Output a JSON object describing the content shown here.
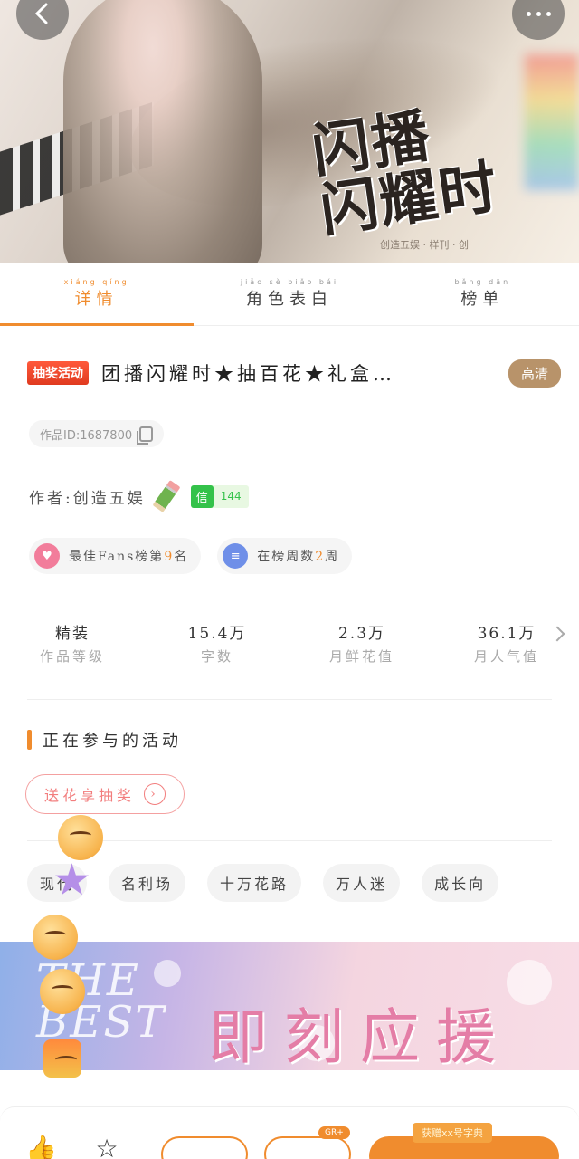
{
  "hero": {
    "title_art": "闪播\n闪耀时",
    "credit": "创造五娱 · 样刊 · 创"
  },
  "tabs": [
    {
      "label": "详情",
      "pinyin": "xiáng qíng",
      "active": true
    },
    {
      "label": "角色表白",
      "pinyin": "jiǎo sè biǎo bái",
      "active": false
    },
    {
      "label": "榜单",
      "pinyin": "bǎng dān",
      "active": false
    }
  ],
  "work": {
    "lottery_badge": "抽奖活动",
    "title": "团播闪耀时★抽百花★礼盒…",
    "hd_badge": "高清",
    "id_label": "作品ID:1687800",
    "author": "作者:创造五娱",
    "letter_badge": {
      "icon": "信",
      "count": "144"
    }
  },
  "ranks": [
    {
      "icon": "heart-icon",
      "prefix": "最佳Fans榜第",
      "num": "9",
      "suffix": "名"
    },
    {
      "icon": "list-icon",
      "prefix": "在榜周数",
      "num": "2",
      "suffix": "周"
    }
  ],
  "stats": [
    {
      "value": "精装",
      "label": "作品等级"
    },
    {
      "value": "15.4万",
      "label": "字数"
    },
    {
      "value": "2.3万",
      "label": "月鲜花值"
    },
    {
      "value": "36.1万",
      "label": "月人气值"
    }
  ],
  "activities": {
    "section_title": "正在参与的活动",
    "gift_button": "送花享抽奖"
  },
  "chips": [
    "现代",
    "名利场",
    "十万花路",
    "万人迷",
    "成长向"
  ],
  "promo": {
    "left_text": "THE BEST",
    "main_text": "即刻应援"
  },
  "bottom": {
    "tag_mini": "GR+",
    "tag_promo": "获赠xx号字典"
  },
  "colors": {
    "accent": "#f08c2e",
    "lottery": "#e03a1f",
    "hd": "#b8936a",
    "green": "#34c24a"
  }
}
